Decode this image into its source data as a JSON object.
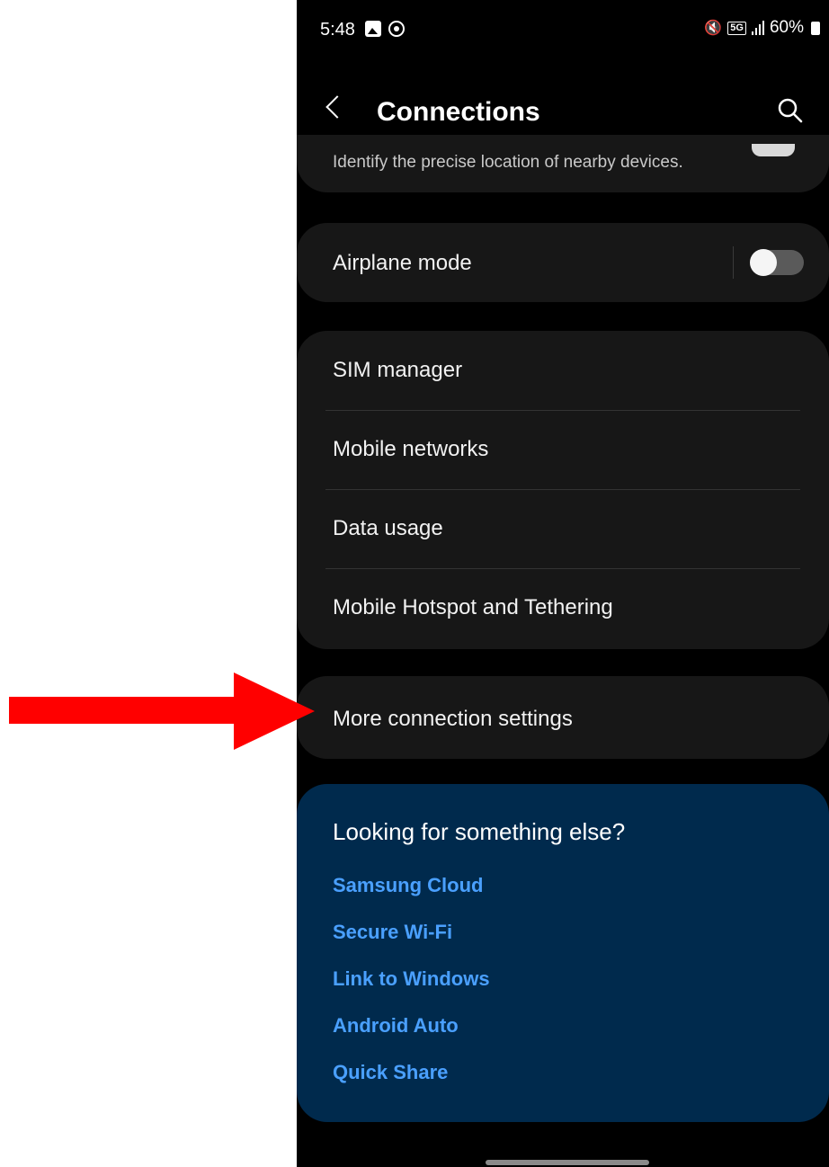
{
  "status_bar": {
    "time": "5:48",
    "network": "5G",
    "battery": "60%",
    "icons": [
      "gallery-icon",
      "radio-icon",
      "mute-icon",
      "5g-icon",
      "signal-icon",
      "battery-icon"
    ]
  },
  "header": {
    "title": "Connections",
    "back_icon": "chevron-left-icon",
    "search_icon": "search-icon"
  },
  "partial_item": {
    "description": "Identify the precise location of nearby devices."
  },
  "airplane": {
    "label": "Airplane mode",
    "toggle_on": false
  },
  "group_items": [
    {
      "label": "SIM manager"
    },
    {
      "label": "Mobile networks"
    },
    {
      "label": "Data usage"
    },
    {
      "label": "Mobile Hotspot and Tethering"
    }
  ],
  "more": {
    "label": "More connection settings"
  },
  "suggestions": {
    "title": "Looking for something else?",
    "links": [
      "Samsung Cloud",
      "Secure Wi-Fi",
      "Link to Windows",
      "Android Auto",
      "Quick Share"
    ]
  },
  "colors": {
    "background": "#000000",
    "card": "#171717",
    "suggestion_card": "#002a4d",
    "link": "#4aa0ff",
    "annotation_arrow": "#ff0000"
  }
}
